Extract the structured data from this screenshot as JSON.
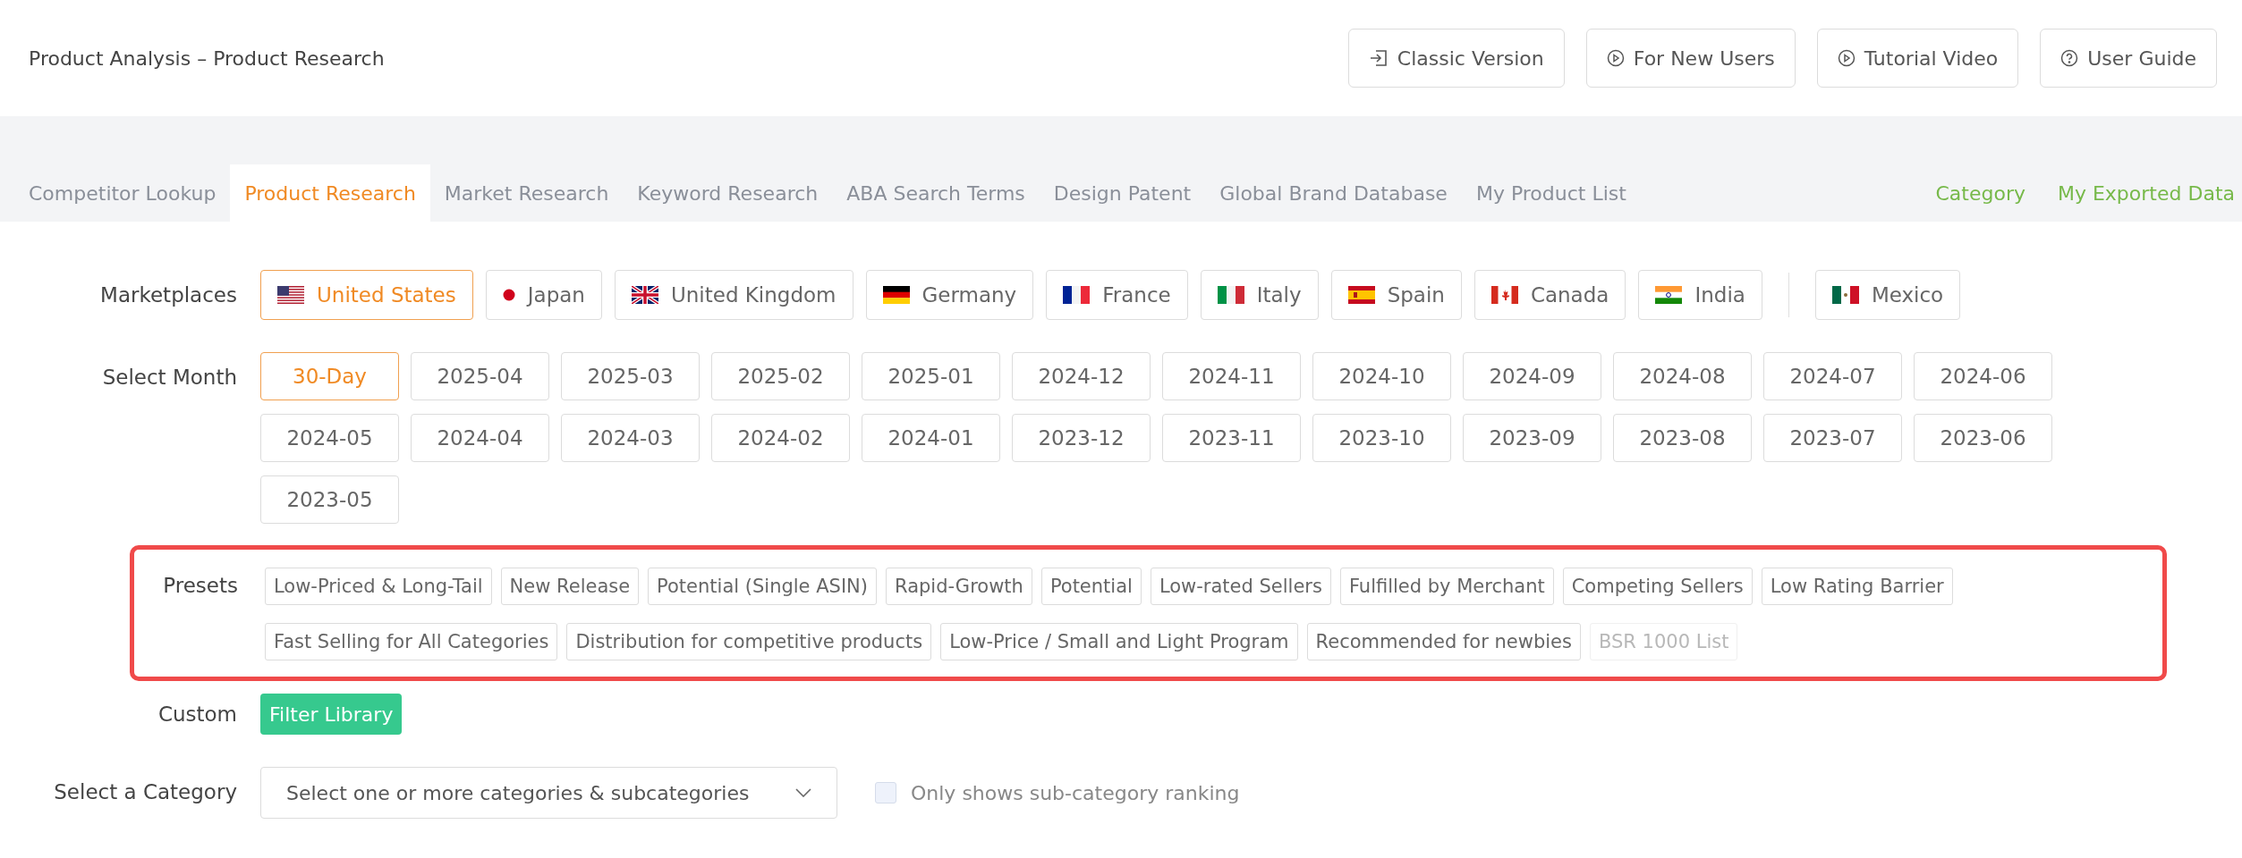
{
  "header": {
    "title": "Product Analysis – Product Research",
    "buttons": [
      {
        "label": "Classic Version",
        "kind": "enter"
      },
      {
        "label": "For New Users",
        "kind": "play"
      },
      {
        "label": "Tutorial Video",
        "kind": "play"
      },
      {
        "label": "User Guide",
        "kind": "help"
      }
    ]
  },
  "tabs": [
    {
      "label": "Competitor Lookup",
      "selected": false
    },
    {
      "label": "Product Research",
      "selected": true
    },
    {
      "label": "Market Research",
      "selected": false
    },
    {
      "label": "Keyword Research",
      "selected": false
    },
    {
      "label": "ABA Search Terms",
      "selected": false
    },
    {
      "label": "Design Patent",
      "selected": false
    },
    {
      "label": "Global Brand Database",
      "selected": false
    },
    {
      "label": "My Product List",
      "selected": false
    }
  ],
  "tab_links": [
    "Category",
    "My Exported Data"
  ],
  "marketplaces": {
    "label": "Marketplaces",
    "items": [
      {
        "label": "United States",
        "kind": "us",
        "selected": true,
        "divider_before": false
      },
      {
        "label": "Japan",
        "kind": "jp",
        "selected": false,
        "divider_before": false
      },
      {
        "label": "United Kingdom",
        "kind": "uk",
        "selected": false,
        "divider_before": false
      },
      {
        "label": "Germany",
        "kind": "de",
        "selected": false,
        "divider_before": false
      },
      {
        "label": "France",
        "kind": "fr",
        "selected": false,
        "divider_before": false
      },
      {
        "label": "Italy",
        "kind": "it",
        "selected": false,
        "divider_before": false
      },
      {
        "label": "Spain",
        "kind": "es",
        "selected": false,
        "divider_before": false
      },
      {
        "label": "Canada",
        "kind": "ca",
        "selected": false,
        "divider_before": false
      },
      {
        "label": "India",
        "kind": "in",
        "selected": false,
        "divider_before": false
      },
      {
        "label": "Mexico",
        "kind": "mx",
        "selected": false,
        "divider_before": true
      }
    ]
  },
  "months": {
    "label": "Select Month",
    "items": [
      {
        "label": "30-Day",
        "selected": true
      },
      {
        "label": "2025-04",
        "selected": false
      },
      {
        "label": "2025-03",
        "selected": false
      },
      {
        "label": "2025-02",
        "selected": false
      },
      {
        "label": "2025-01",
        "selected": false
      },
      {
        "label": "2024-12",
        "selected": false
      },
      {
        "label": "2024-11",
        "selected": false
      },
      {
        "label": "2024-10",
        "selected": false
      },
      {
        "label": "2024-09",
        "selected": false
      },
      {
        "label": "2024-08",
        "selected": false
      },
      {
        "label": "2024-07",
        "selected": false
      },
      {
        "label": "2024-06",
        "selected": false
      },
      {
        "label": "2024-05",
        "selected": false
      },
      {
        "label": "2024-04",
        "selected": false
      },
      {
        "label": "2024-03",
        "selected": false
      },
      {
        "label": "2024-02",
        "selected": false
      },
      {
        "label": "2024-01",
        "selected": false
      },
      {
        "label": "2023-12",
        "selected": false
      },
      {
        "label": "2023-11",
        "selected": false
      },
      {
        "label": "2023-10",
        "selected": false
      },
      {
        "label": "2023-09",
        "selected": false
      },
      {
        "label": "2023-08",
        "selected": false
      },
      {
        "label": "2023-07",
        "selected": false
      },
      {
        "label": "2023-06",
        "selected": false
      },
      {
        "label": "2023-05",
        "selected": false
      }
    ]
  },
  "presets": {
    "label": "Presets",
    "highlighted": true,
    "items": [
      {
        "label": "Low-Priced & Long-Tail",
        "disabled": false
      },
      {
        "label": "New Release",
        "disabled": false
      },
      {
        "label": "Potential (Single ASIN)",
        "disabled": false
      },
      {
        "label": "Rapid-Growth",
        "disabled": false
      },
      {
        "label": "Potential",
        "disabled": false
      },
      {
        "label": "Low-rated Sellers",
        "disabled": false
      },
      {
        "label": "Fulfilled by Merchant",
        "disabled": false
      },
      {
        "label": "Competing Sellers",
        "disabled": false
      },
      {
        "label": "Low Rating Barrier",
        "disabled": false
      },
      {
        "label": "Fast Selling for All Categories",
        "disabled": false
      },
      {
        "label": "Distribution for competitive products",
        "disabled": false
      },
      {
        "label": "Low-Price / Small and Light Program",
        "disabled": false
      },
      {
        "label": "Recommended for newbies",
        "disabled": false
      },
      {
        "label": "BSR 1000 List",
        "disabled": true
      }
    ]
  },
  "custom": {
    "label": "Custom",
    "button": "Filter Library"
  },
  "category": {
    "label": "Select a Category",
    "placeholder": "Select one or more categories & subcategories",
    "checkbox": {
      "label": "Only shows sub-category ranking",
      "checked": false
    }
  }
}
